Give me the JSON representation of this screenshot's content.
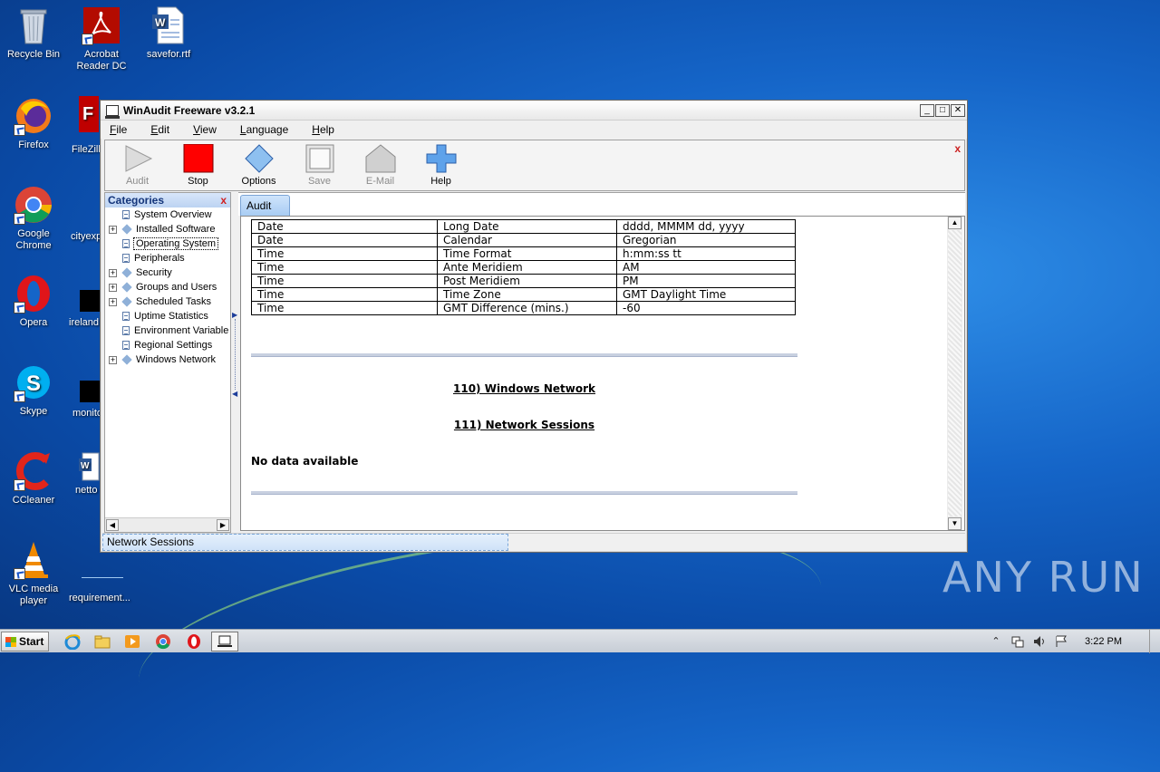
{
  "desktop": {
    "icons": [
      {
        "label": "Recycle Bin"
      },
      {
        "label": "Acrobat Reader DC"
      },
      {
        "label": "savefor.rtf"
      },
      {
        "label": "Firefox"
      },
      {
        "label": "FileZilla"
      },
      {
        "label": "Google Chrome"
      },
      {
        "label": "cityexp"
      },
      {
        "label": "Opera"
      },
      {
        "label": "ireland"
      },
      {
        "label": "Skype"
      },
      {
        "label": "monito"
      },
      {
        "label": "CCleaner"
      },
      {
        "label": "netto"
      },
      {
        "label": "VLC media player"
      },
      {
        "label": "requirement..."
      }
    ],
    "watermark": "ANY RUN"
  },
  "window": {
    "title": "WinAudit Freeware v3.2.1",
    "controls": {
      "minimize": "_",
      "maximize": "□",
      "close": "✕"
    },
    "menu": [
      "File",
      "Edit",
      "View",
      "Language",
      "Help"
    ],
    "toolbar": [
      {
        "label": "Audit",
        "icon": "play-icon",
        "enabled": false
      },
      {
        "label": "Stop",
        "icon": "stop-icon",
        "enabled": true
      },
      {
        "label": "Options",
        "icon": "options-diamond-icon",
        "enabled": true
      },
      {
        "label": "Save",
        "icon": "save-icon",
        "enabled": false
      },
      {
        "label": "E-Mail",
        "icon": "email-icon",
        "enabled": false
      },
      {
        "label": "Help",
        "icon": "help-plus-icon",
        "enabled": true
      }
    ],
    "toolbar_close": "x",
    "categories": {
      "header": "Categories",
      "close": "x",
      "items": [
        {
          "label": "System Overview",
          "expandable": false,
          "icon": "doc"
        },
        {
          "label": "Installed Software",
          "expandable": true,
          "icon": "diamond"
        },
        {
          "label": "Operating System",
          "expandable": false,
          "icon": "doc",
          "selected": true
        },
        {
          "label": "Peripherals",
          "expandable": false,
          "icon": "doc"
        },
        {
          "label": "Security",
          "expandable": true,
          "icon": "diamond"
        },
        {
          "label": "Groups and Users",
          "expandable": true,
          "icon": "diamond"
        },
        {
          "label": "Scheduled Tasks",
          "expandable": true,
          "icon": "diamond"
        },
        {
          "label": "Uptime Statistics",
          "expandable": false,
          "icon": "doc"
        },
        {
          "label": "Environment Variable",
          "expandable": false,
          "icon": "doc"
        },
        {
          "label": "Regional Settings",
          "expandable": false,
          "icon": "doc"
        },
        {
          "label": "Windows Network",
          "expandable": true,
          "icon": "diamond"
        }
      ]
    },
    "tab": "Audit",
    "report": {
      "rows": [
        [
          "Date",
          "Long Date",
          "dddd, MMMM dd, yyyy"
        ],
        [
          "Date",
          "Calendar",
          "Gregorian"
        ],
        [
          "Time",
          "Time Format",
          "h:mm:ss tt"
        ],
        [
          "Time",
          "Ante Meridiem",
          "AM"
        ],
        [
          "Time",
          "Post Meridiem",
          "PM"
        ],
        [
          "Time",
          "Time Zone",
          "GMT Daylight Time"
        ],
        [
          "Time",
          "GMT Difference (mins.)",
          "-60"
        ]
      ],
      "section_1": "110) Windows Network",
      "section_2": "111) Network Sessions",
      "no_data": "No data available"
    },
    "status": "Network Sessions"
  },
  "taskbar": {
    "start": "Start",
    "clock": "3:22 PM"
  }
}
